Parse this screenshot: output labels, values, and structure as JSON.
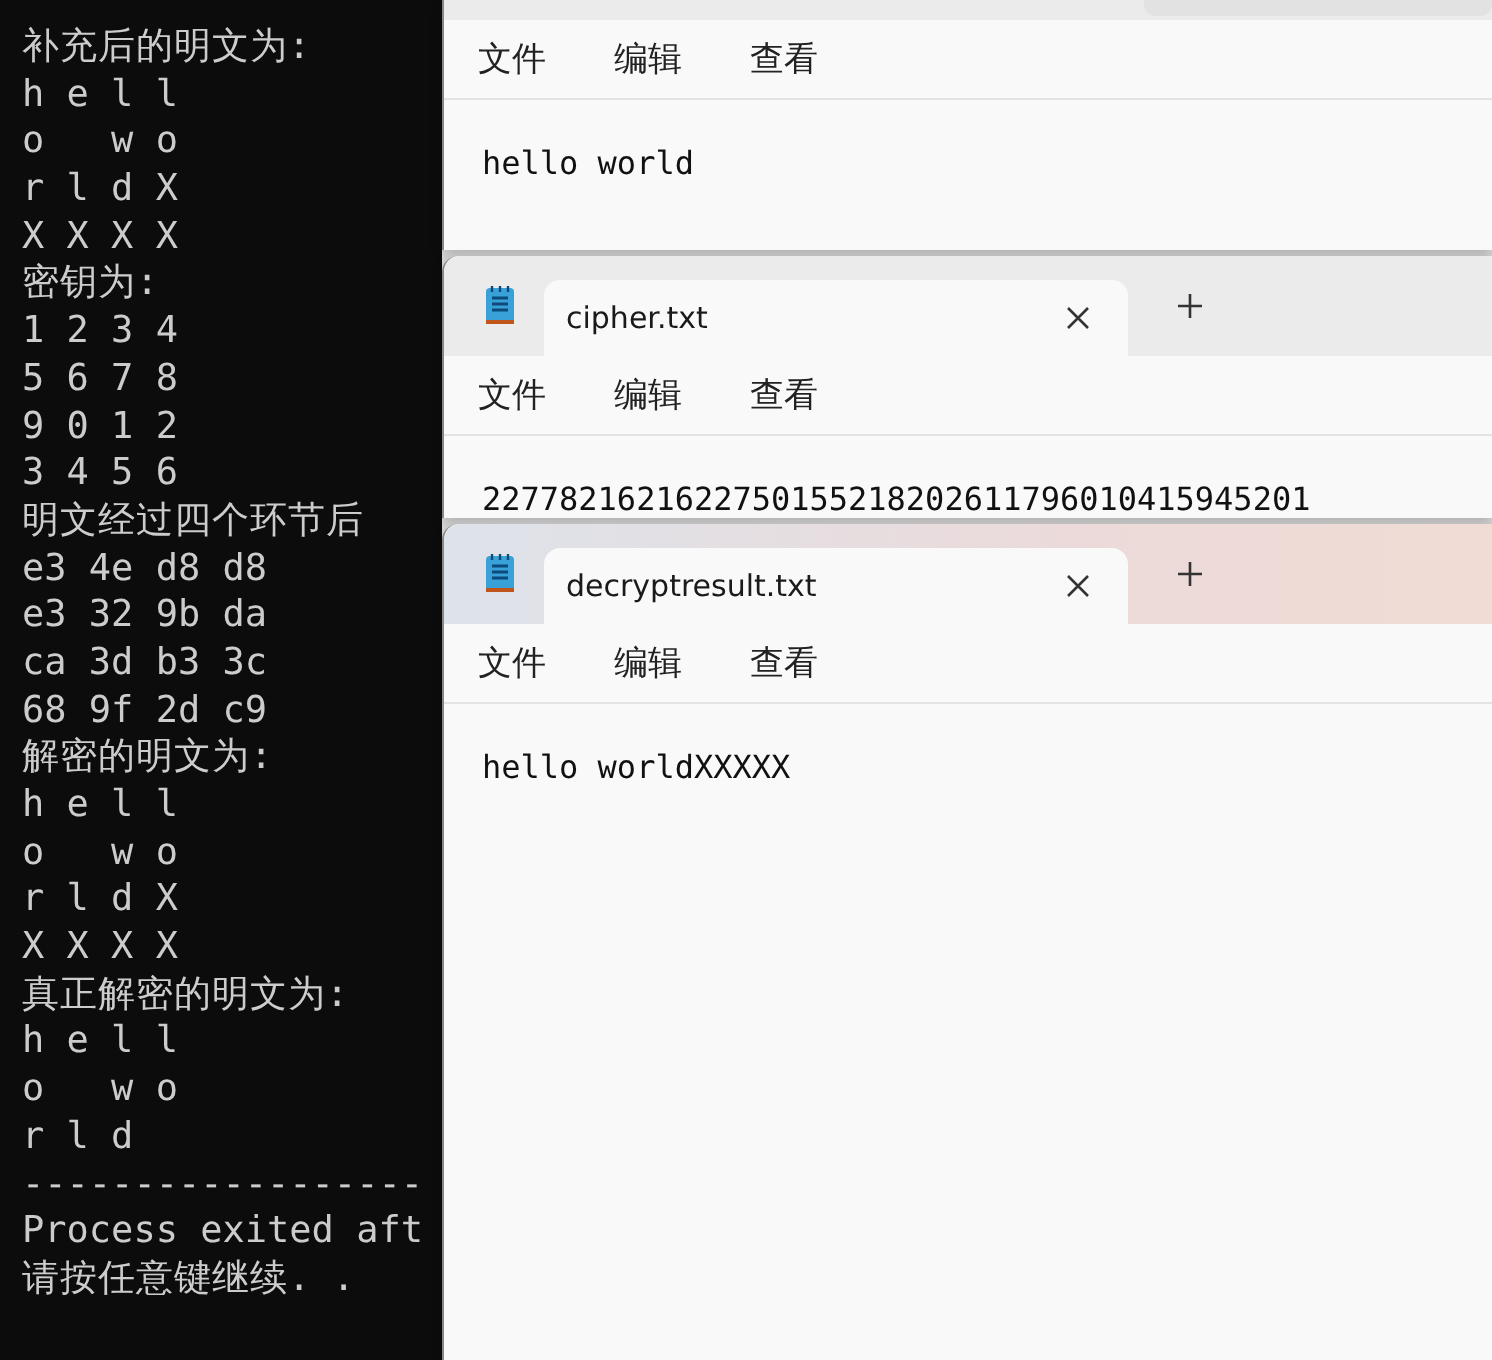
{
  "console": {
    "lines": [
      "补充后的明文为:",
      "h e l l",
      "o   w o",
      "r l d X",
      "X X X X",
      "密钥为:",
      "1 2 3 4",
      "5 6 7 8",
      "9 0 1 2",
      "3 4 5 6",
      "明文经过四个环节后",
      "e3 4e d8 d8",
      "e3 32 9b da",
      "ca 3d b3 3c",
      "68 9f 2d c9",
      "解密的明文为:",
      "h e l l",
      "o   w o",
      "r l d X",
      "X X X X",
      "真正解密的明文为:",
      "h e l l",
      "o   w o",
      "r l d",
      "------------------",
      "Process exited aft",
      "请按任意键继续. ."
    ]
  },
  "windows": [
    {
      "focused": false,
      "menu": [
        "文件",
        "编辑",
        "查看"
      ],
      "content": "hello world"
    },
    {
      "focused": false,
      "tab": {
        "title": "cipher.txt"
      },
      "menu": [
        "文件",
        "编辑",
        "查看"
      ],
      "content": "2277821621622750155218202611796010415945201"
    },
    {
      "focused": true,
      "tab": {
        "title": "decryptresult.txt"
      },
      "menu": [
        "文件",
        "编辑",
        "查看"
      ],
      "content": "hello worldXXXXX"
    }
  ]
}
